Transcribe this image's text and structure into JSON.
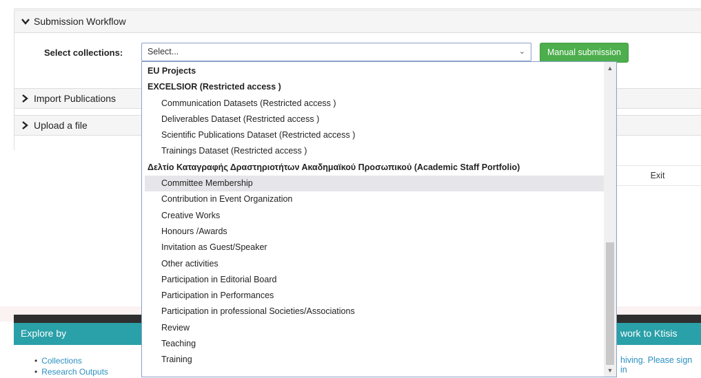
{
  "workflow": {
    "submission_title": "Submission Workflow",
    "import_title": "Import Publications",
    "upload_title": "Upload a file",
    "select_label": "Select collections:",
    "select_value": "Select...",
    "manual_button": "Manual submission",
    "exit_button": "Exit"
  },
  "dropdown": {
    "items": [
      {
        "label": "EU Projects",
        "kind": "group"
      },
      {
        "label": "EXCELSIOR (Restricted access )",
        "kind": "group"
      },
      {
        "label": "Communication Datasets (Restricted access )",
        "kind": "child"
      },
      {
        "label": "Deliverables Dataset (Restricted access )",
        "kind": "child"
      },
      {
        "label": "Scientific Publications Dataset (Restricted access )",
        "kind": "child"
      },
      {
        "label": "Trainings Dataset (Restricted access )",
        "kind": "child"
      },
      {
        "label": "Δελτίο Καταγραφής Δραστηριοτήτων Ακαδημαϊκού Προσωπικού (Academic Staff Portfolio)",
        "kind": "group"
      },
      {
        "label": "Committee Membership",
        "kind": "child",
        "highlighted": true
      },
      {
        "label": "Contribution in Event Organization",
        "kind": "child"
      },
      {
        "label": "Creative Works",
        "kind": "child"
      },
      {
        "label": "Honours /Awards",
        "kind": "child"
      },
      {
        "label": "Invitation as Guest/Speaker",
        "kind": "child"
      },
      {
        "label": "Other activities",
        "kind": "child"
      },
      {
        "label": "Participation in Editorial Board",
        "kind": "child"
      },
      {
        "label": "Participation in Performances",
        "kind": "child"
      },
      {
        "label": "Participation in professional Societies/Associations",
        "kind": "child"
      },
      {
        "label": "Review",
        "kind": "child"
      },
      {
        "label": "Teaching",
        "kind": "child"
      },
      {
        "label": "Training",
        "kind": "child"
      }
    ]
  },
  "footer": {
    "explore_title": "Explore by",
    "submit_title": "work to Ktisis",
    "submit_text": "hiving. Please sign in",
    "links": [
      "Collections",
      "Research Outputs"
    ]
  },
  "colors": {
    "accent_green": "#4cae4c",
    "footer_teal": "#2aa0a8",
    "link_blue": "#2a8fbf",
    "highlight": "#e6e6ea"
  },
  "icons": {
    "expanded": "chevron-down-icon",
    "collapsed": "chevron-right-icon",
    "select_caret": "caret-down-icon"
  }
}
